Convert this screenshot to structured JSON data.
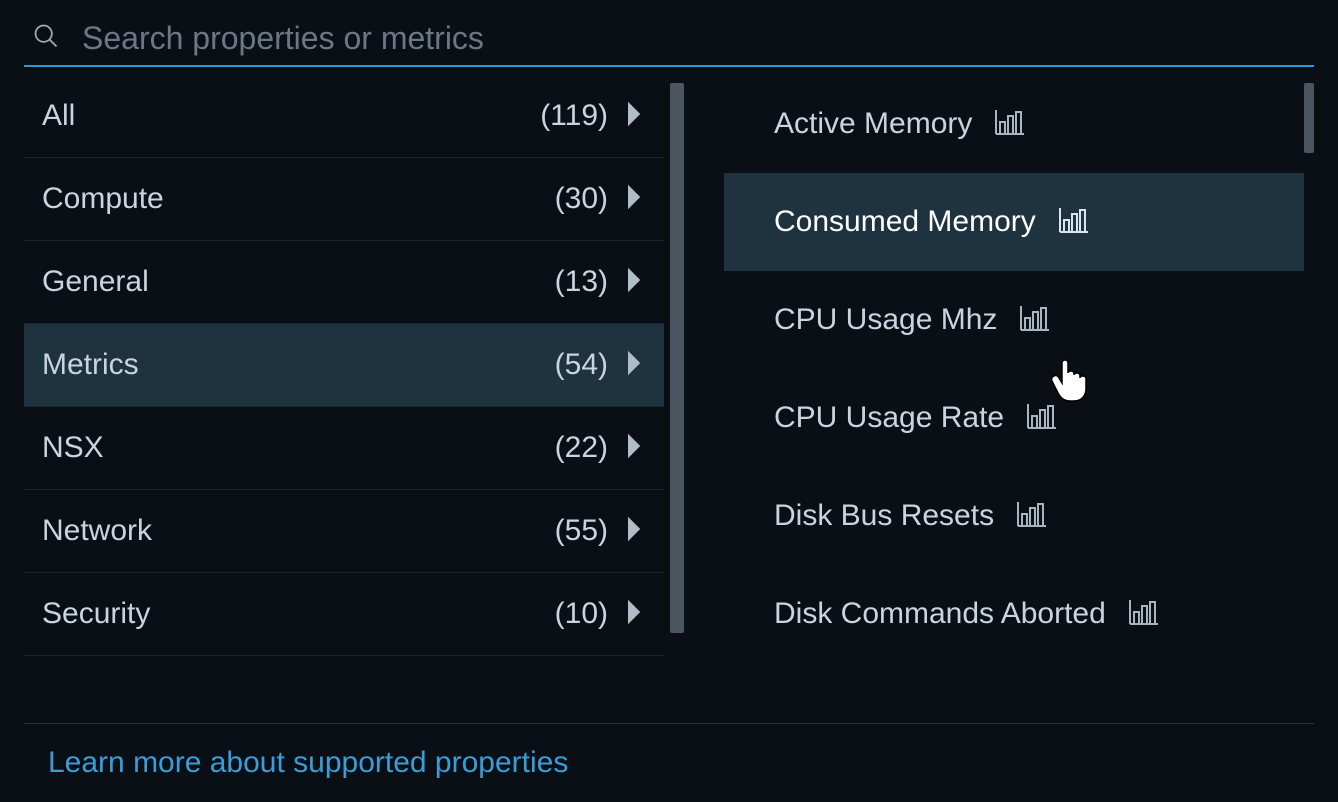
{
  "search": {
    "placeholder": "Search properties or metrics"
  },
  "categories": [
    {
      "label": "All",
      "count": "(119)",
      "selected": false
    },
    {
      "label": "Compute",
      "count": "(30)",
      "selected": false
    },
    {
      "label": "General",
      "count": "(13)",
      "selected": false
    },
    {
      "label": "Metrics",
      "count": "(54)",
      "selected": true
    },
    {
      "label": "NSX",
      "count": "(22)",
      "selected": false
    },
    {
      "label": "Network",
      "count": "(55)",
      "selected": false
    },
    {
      "label": "Security",
      "count": "(10)",
      "selected": false
    }
  ],
  "metrics": [
    {
      "label": "Active Memory",
      "hovered": false
    },
    {
      "label": "Consumed Memory",
      "hovered": true
    },
    {
      "label": "CPU Usage Mhz",
      "hovered": false
    },
    {
      "label": "CPU Usage Rate",
      "hovered": false
    },
    {
      "label": "Disk Bus Resets",
      "hovered": false
    },
    {
      "label": "Disk Commands Aborted",
      "hovered": false
    }
  ],
  "footer": {
    "link": "Learn more about supported properties"
  }
}
